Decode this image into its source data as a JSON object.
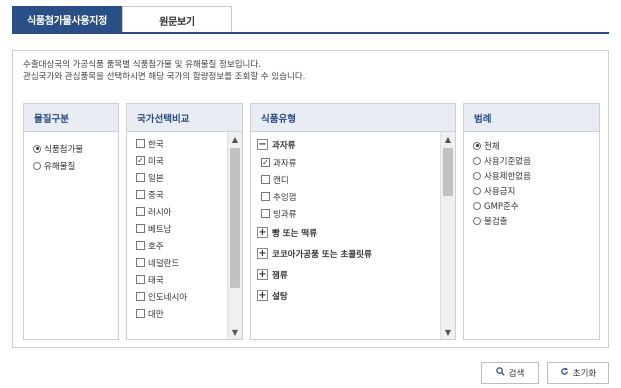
{
  "tabs": [
    {
      "label": "식품첨가물사용지정"
    },
    {
      "label": "원문보기"
    }
  ],
  "description": {
    "line1": "수출대상국의 가공식품 품목별 식품첨가물 및 유해물질 정보입니다.",
    "line2": "관심국가와 관심품목을 선택하시면 해당 국가의 함량정보를 조회할 수 있습니다."
  },
  "material": {
    "header": "물질구분",
    "options": [
      {
        "label": "식품첨가물",
        "selected": true
      },
      {
        "label": "유해물질",
        "selected": false
      }
    ]
  },
  "country": {
    "header": "국가선택비교",
    "items": [
      {
        "label": "한국",
        "checked": false
      },
      {
        "label": "미국",
        "checked": true
      },
      {
        "label": "일본",
        "checked": false
      },
      {
        "label": "중국",
        "checked": false
      },
      {
        "label": "러시아",
        "checked": false
      },
      {
        "label": "베트남",
        "checked": false
      },
      {
        "label": "호주",
        "checked": false
      },
      {
        "label": "네덜란드",
        "checked": false
      },
      {
        "label": "태국",
        "checked": false
      },
      {
        "label": "인도네시아",
        "checked": false
      },
      {
        "label": "대만",
        "checked": false
      }
    ]
  },
  "food_type": {
    "header": "식품유형",
    "groups": [
      {
        "label": "과자류",
        "expanded": true,
        "items": [
          {
            "label": "과자류",
            "checked": true
          },
          {
            "label": "캔디",
            "checked": false
          },
          {
            "label": "추잉껌",
            "checked": false
          },
          {
            "label": "빙과류",
            "checked": false
          }
        ]
      },
      {
        "label": "빵 또는 떡류",
        "expanded": false,
        "items": []
      },
      {
        "label": "코코아가공품 또는 초콜릿류",
        "expanded": false,
        "items": []
      },
      {
        "label": "잼류",
        "expanded": false,
        "items": []
      },
      {
        "label": "설탕",
        "expanded": false,
        "items": []
      }
    ]
  },
  "legend": {
    "header": "범례",
    "options": [
      {
        "label": "전체",
        "selected": true
      },
      {
        "label": "사용기준없음",
        "selected": false
      },
      {
        "label": "사용제한없음",
        "selected": false
      },
      {
        "label": "사용금지",
        "selected": false
      },
      {
        "label": "GMP준수",
        "selected": false
      },
      {
        "label": "불검출",
        "selected": false
      }
    ]
  },
  "buttons": {
    "search": "검색",
    "reset": "초기화"
  },
  "colors": {
    "accent": "#2a4f86",
    "panel_header_bg": "#e9ecf3"
  }
}
